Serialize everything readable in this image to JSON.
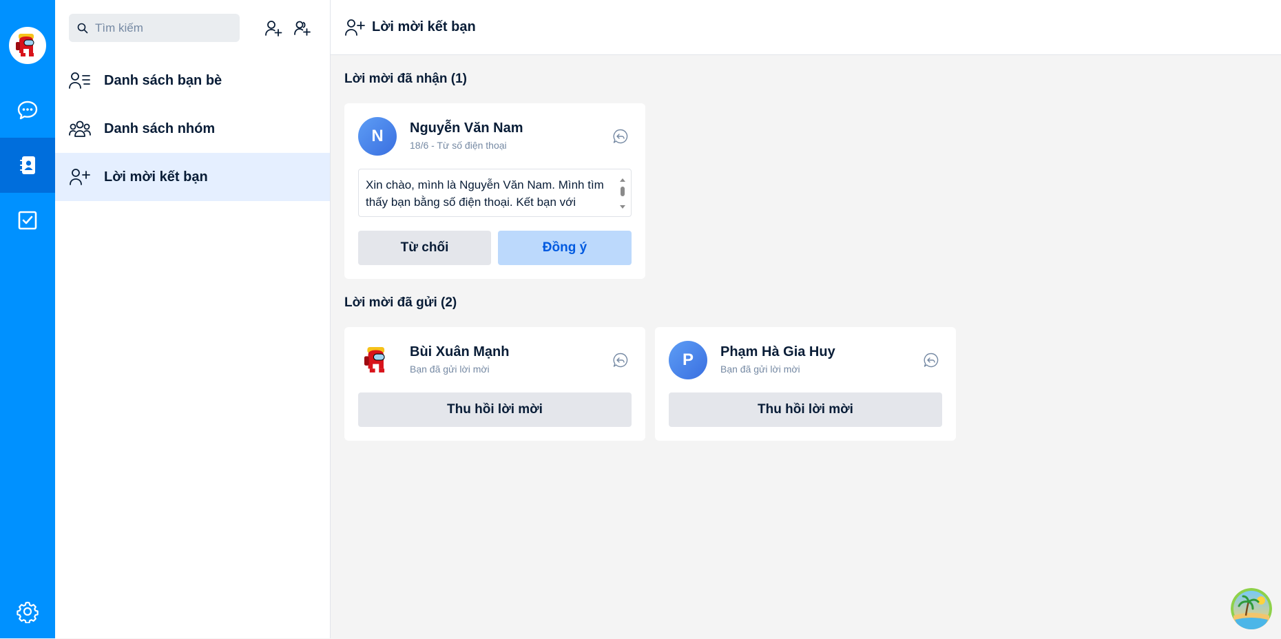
{
  "search": {
    "placeholder": "Tìm kiếm"
  },
  "sidebar": {
    "items": [
      {
        "label": "Danh sách bạn bè",
        "icon": "friend-list-icon"
      },
      {
        "label": "Danh sách nhóm",
        "icon": "group-list-icon"
      },
      {
        "label": "Lời mời kết bạn",
        "icon": "add-friend-icon",
        "active": true
      }
    ]
  },
  "header": {
    "title": "Lời mời kết bạn"
  },
  "received": {
    "title": "Lời mời đã nhận (1)",
    "items": [
      {
        "avatar_letter": "N",
        "name": "Nguyễn Văn Nam",
        "subtitle": "18/6 - Từ số điện thoại",
        "message": "Xin chào, mình là Nguyễn Văn Nam. Mình tìm thấy bạn bằng số điện thoại. Kết bạn với",
        "reject_label": "Từ chối",
        "accept_label": "Đồng ý"
      }
    ]
  },
  "sent": {
    "title": "Lời mời đã gửi (2)",
    "items": [
      {
        "avatar_letter": "",
        "name": "Bùi Xuân Mạnh",
        "subtitle": "Bạn đã gửi lời mời",
        "recall_label": "Thu hồi lời mời"
      },
      {
        "avatar_letter": "P",
        "name": "Phạm Hà Gia Huy",
        "subtitle": "Bạn đã gửi lời mời",
        "recall_label": "Thu hồi lời mời"
      }
    ]
  },
  "colors": {
    "rail": "#0091ff",
    "rail_active": "#006edc",
    "active_item": "#e5efff",
    "accept_bg": "#bcd9fc",
    "accept_text": "#005ae0"
  }
}
